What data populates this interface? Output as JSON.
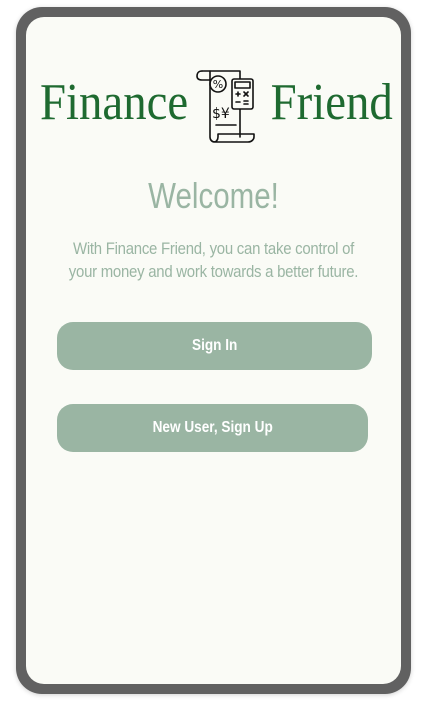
{
  "brand": {
    "word_left": "Finance",
    "word_right": "Friend",
    "icon": "finance-document-calculator-icon",
    "color": "#1e6a30"
  },
  "welcome": {
    "title": "Welcome!",
    "tagline": "With Finance Friend, you can take control of your money and work towards a better future."
  },
  "actions": {
    "sign_in_label": "Sign In",
    "sign_up_label": "New User, Sign Up"
  },
  "colors": {
    "accent": "#9ab5a3",
    "screen_background": "#fafbf6",
    "device_frame": "#616161"
  }
}
